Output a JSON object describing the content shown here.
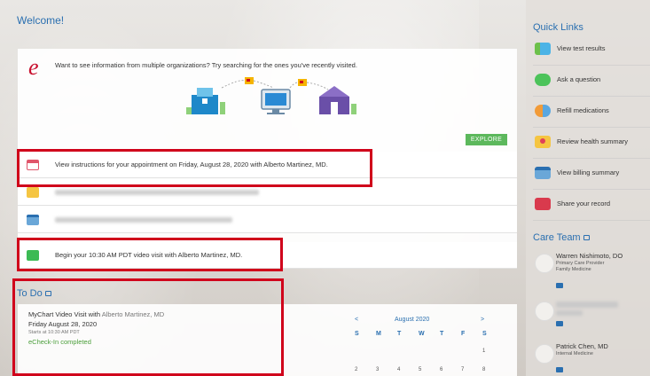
{
  "welcome": {
    "title": "Welcome!"
  },
  "card": {
    "message": "Want to see information from multiple organizations? Try searching for the ones you've recently visited.",
    "explore_label": "EXPLORE"
  },
  "notifications": [
    {
      "text": "View instructions for your appointment on Friday, August 28, 2020 with Alberto Martinez, MD."
    },
    {
      "text": ""
    },
    {
      "text": ""
    },
    {
      "text": "Begin your 10:30 AM PDT video visit with Alberto Martinez, MD."
    }
  ],
  "todo": {
    "title": "To Do",
    "visit_title": "MyChart Video Visit with ",
    "visit_provider": "Alberto Martinez, MD",
    "date": "Friday August 28, 2020",
    "starts": "Starts at 10:30 AM PDT",
    "status": "eCheck-In completed"
  },
  "calendar": {
    "prev": "<",
    "next": ">",
    "month": "August 2020",
    "days_of_week": [
      "S",
      "M",
      "T",
      "W",
      "T",
      "F",
      "S"
    ],
    "first_row": [
      "1"
    ],
    "second_row": [
      "2",
      "3",
      "4",
      "5",
      "6",
      "7",
      "8"
    ]
  },
  "quick_links": {
    "title": "Quick Links",
    "items": [
      {
        "label": "View test results",
        "icon": "test-tube-icon"
      },
      {
        "label": "Ask a question",
        "icon": "chat-bubble-icon"
      },
      {
        "label": "Refill medications",
        "icon": "pill-icon"
      },
      {
        "label": "Review health summary",
        "icon": "heart-folder-icon"
      },
      {
        "label": "View billing summary",
        "icon": "credit-card-icon"
      },
      {
        "label": "Share your record",
        "icon": "share-folder-icon"
      }
    ]
  },
  "care_team": {
    "title": "Care Team",
    "members": [
      {
        "name": "Warren Nishimoto, DO",
        "role": "Primary Care Provider",
        "specialty": "Family Medicine"
      },
      {
        "name": "",
        "role": "",
        "specialty": ""
      },
      {
        "name": "Patrick Chen, MD",
        "role": "Internal Medicine",
        "specialty": ""
      }
    ]
  },
  "colors": {
    "accent": "#2a6fb0",
    "explore": "#5cb85c",
    "highlight": "#d0021b",
    "status": "#4a9e3a"
  }
}
